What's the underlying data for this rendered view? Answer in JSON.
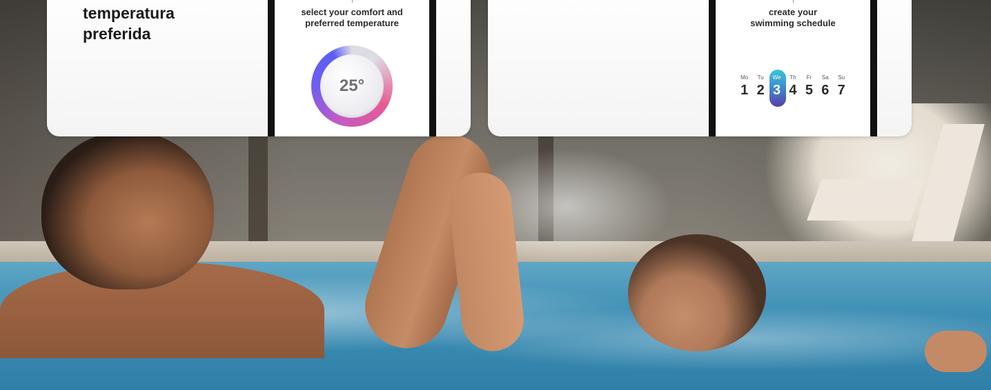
{
  "card_left": {
    "headline": [
      "temperatura",
      "preferida"
    ],
    "phone_caption": [
      "select your comfort and",
      "preferred temperature"
    ],
    "temperature": "25°",
    "temperature_level": 0.8
  },
  "card_right": {
    "phone_caption": [
      "create your",
      "swimming schedule"
    ],
    "days": [
      {
        "name": "Mo",
        "num": "1"
      },
      {
        "name": "Tu",
        "num": "2"
      },
      {
        "name": "We",
        "num": "3",
        "active": true
      },
      {
        "name": "Th",
        "num": "4"
      },
      {
        "name": "Fr",
        "num": "5"
      },
      {
        "name": "Sa",
        "num": "6"
      },
      {
        "name": "Su",
        "num": "7"
      }
    ]
  },
  "colors": {
    "dial_gradient": [
      "#5c5ef5",
      "#c35bc4",
      "#e85a93"
    ],
    "active_day_gradient": [
      "#3bc6d6",
      "#3c8fd1",
      "#5a3fa8"
    ],
    "water": "#3e8fb5"
  }
}
